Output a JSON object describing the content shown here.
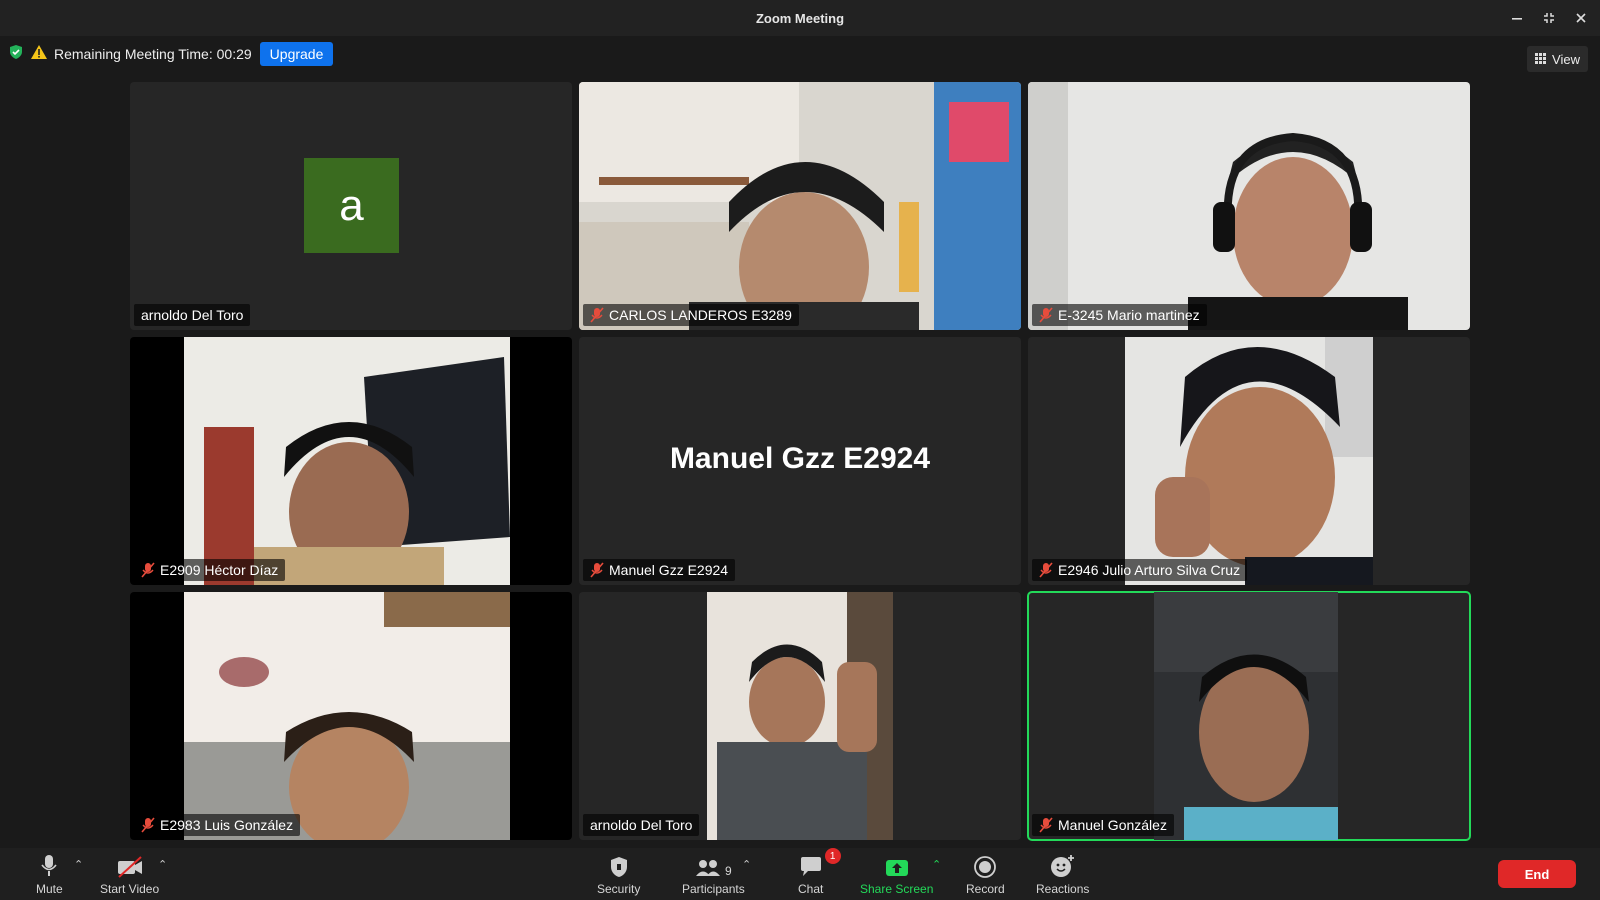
{
  "window": {
    "title": "Zoom Meeting",
    "controls": [
      "minimize-icon",
      "exit-fullscreen-icon",
      "close-icon"
    ]
  },
  "info_bar": {
    "remaining_time": "Remaining Meeting Time: 00:29",
    "upgrade_label": "Upgrade"
  },
  "view_button": {
    "label": "View",
    "icon": "grid-icon"
  },
  "participants_tiles": [
    {
      "name": "arnoldo Del Toro",
      "avatar_letter": "a",
      "muted": false,
      "video": false
    },
    {
      "name": "CARLOS LANDEROS E3289",
      "muted": true,
      "video": true
    },
    {
      "name": "E-3245 Mario martinez",
      "muted": true,
      "video": true
    },
    {
      "name": "E2909 Héctor Díaz",
      "muted": true,
      "video": true
    },
    {
      "name": "Manuel Gzz E2924",
      "big_name": "Manuel Gzz E2924",
      "muted": true,
      "video": false
    },
    {
      "name": "E2946 Julio Arturo Silva Cruz",
      "muted": true,
      "video": true
    },
    {
      "name": "E2983 Luis González",
      "muted": true,
      "video": true
    },
    {
      "name": "arnoldo Del Toro",
      "muted": false,
      "video": true
    },
    {
      "name": "Manuel González",
      "muted": true,
      "video": true,
      "active_speaker": true
    }
  ],
  "toolbar": {
    "mute": "Mute",
    "start_video": "Start Video",
    "security": "Security",
    "participants": "Participants",
    "participants_count": "9",
    "chat": "Chat",
    "chat_badge": "1",
    "share_screen": "Share Screen",
    "record": "Record",
    "reactions": "Reactions",
    "end": "End"
  },
  "colors": {
    "accent_blue": "#0e72ed",
    "share_green": "#23d959",
    "end_red": "#e02828",
    "avatar_green": "#3a6b1f"
  }
}
